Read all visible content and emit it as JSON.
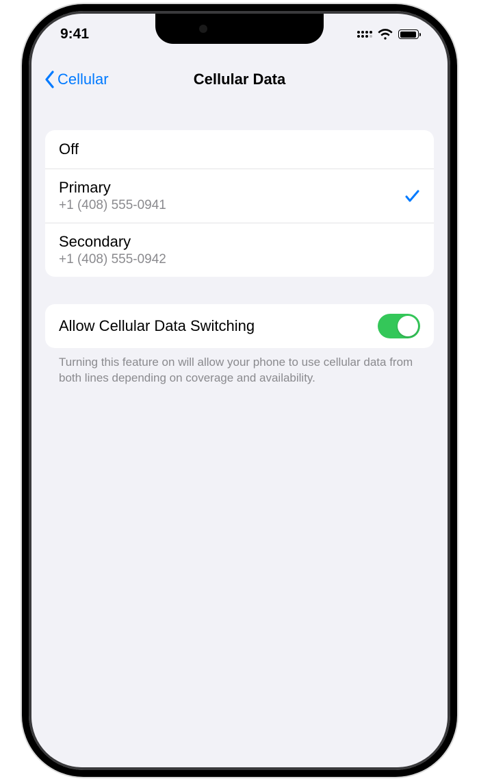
{
  "statusbar": {
    "time": "9:41"
  },
  "nav": {
    "back": "Cellular",
    "title": "Cellular Data"
  },
  "options": [
    {
      "label": "Off",
      "sub": "",
      "selected": false
    },
    {
      "label": "Primary",
      "sub": "+1 (408) 555-0941",
      "selected": true
    },
    {
      "label": "Secondary",
      "sub": "+1 (408) 555-0942",
      "selected": false
    }
  ],
  "switching": {
    "label": "Allow Cellular Data Switching",
    "on": true,
    "footer": "Turning this feature on will allow your phone to use cellular data from both lines depending on coverage and availability."
  }
}
